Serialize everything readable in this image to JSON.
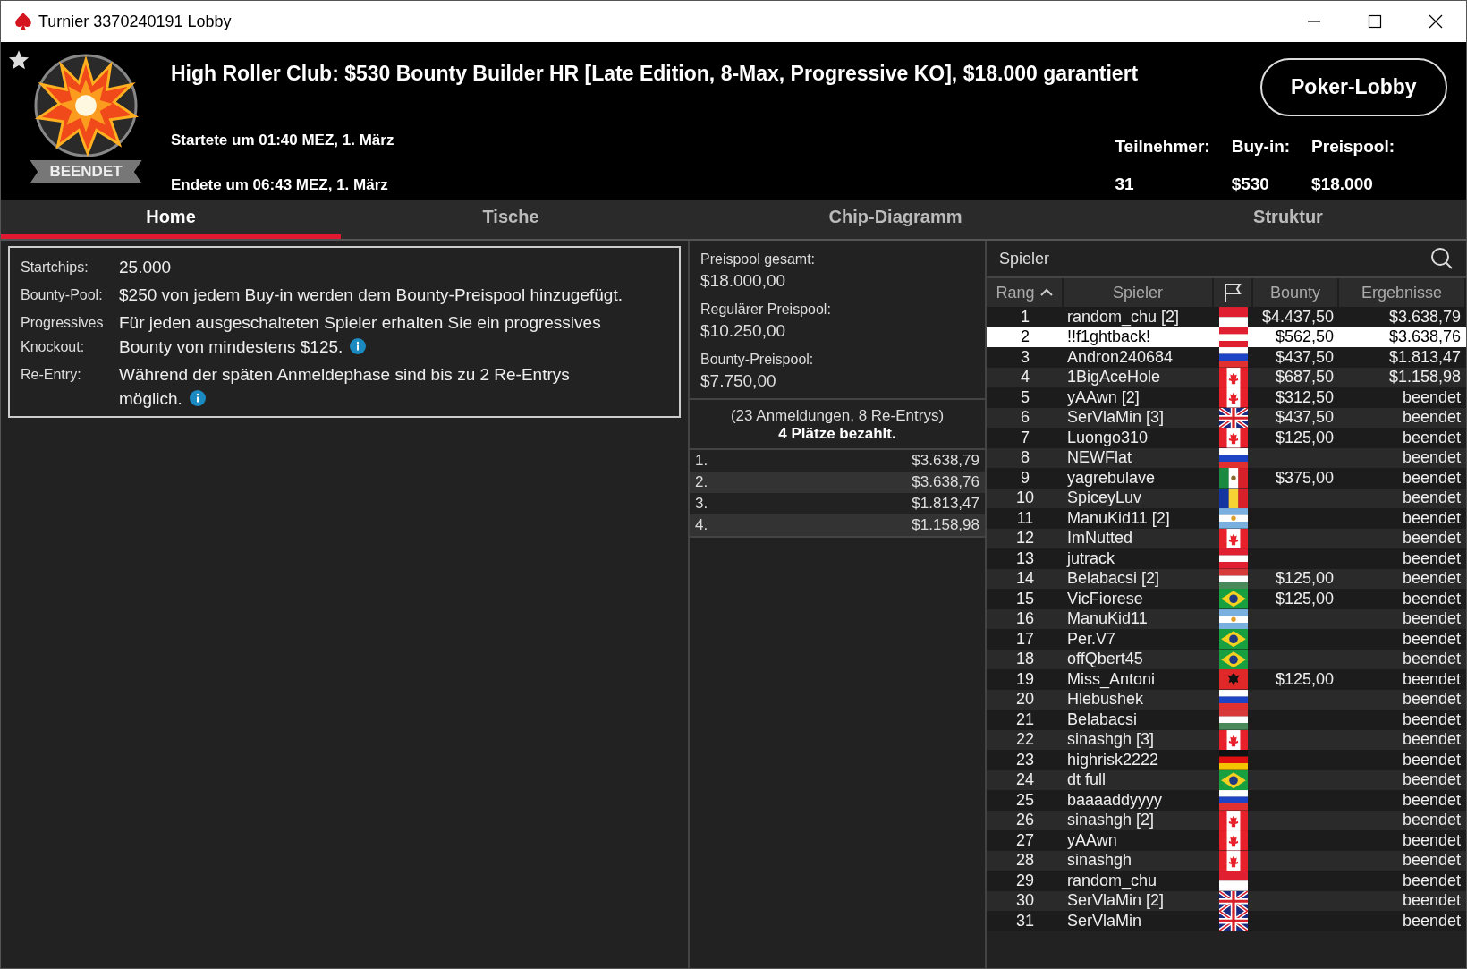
{
  "window": {
    "title": "Turnier 3370240191 Lobby"
  },
  "header": {
    "status": "BEENDET",
    "title": "High Roller Club: $530 Bounty Builder HR [Late Edition, 8-Max, Progressive KO], $18.000 garantiert",
    "started": "Startete um 01:40 MEZ, 1. März",
    "ended": "Endete um 06:43 MEZ, 1. März",
    "lobby_button": "Poker-Lobby",
    "stats": [
      {
        "label": "Teilnehmer:",
        "value": "31"
      },
      {
        "label": "Buy-in:",
        "value": "$530"
      },
      {
        "label": "Preispool:",
        "value": "$18.000"
      }
    ]
  },
  "tabs": [
    {
      "label": "Home",
      "selected": true
    },
    {
      "label": "Tische",
      "selected": false
    },
    {
      "label": "Chip-Diagramm",
      "selected": false
    },
    {
      "label": "Struktur",
      "selected": false
    }
  ],
  "info": [
    {
      "label": "Startchips:",
      "text": "25.000",
      "info_icon": false
    },
    {
      "label": "Bounty-Pool:",
      "text": "$250 von jedem Buy-in werden dem Bounty-Preispool hinzugefügt.",
      "info_icon": false
    },
    {
      "label": "Progressives Knockout:",
      "text": "Für jeden ausgeschalteten Spieler erhalten Sie ein progressives Bounty von mindestens $125.",
      "info_icon": true
    },
    {
      "label": "Re-Entry:",
      "text": "Während der späten Anmeldephase sind bis zu 2 Re-Entrys möglich.",
      "info_icon": true
    }
  ],
  "prizepool": [
    {
      "label": "Preispool gesamt:",
      "value": "$18.000,00"
    },
    {
      "label": "Regulärer Preispool:",
      "value": "$10.250,00"
    },
    {
      "label": "Bounty-Preispool:",
      "value": "$7.750,00"
    }
  ],
  "entries": "(23 Anmeldungen, 8 Re-Entrys)",
  "paid": "4 Plätze bezahlt.",
  "payouts": [
    {
      "place": "1.",
      "amount": "$3.638,79"
    },
    {
      "place": "2.",
      "amount": "$3.638,76"
    },
    {
      "place": "3.",
      "amount": "$1.813,47"
    },
    {
      "place": "4.",
      "amount": "$1.158,98"
    }
  ],
  "players": {
    "search_label": "Spieler",
    "columns": [
      "Rang",
      "Spieler",
      "Bounty",
      "Ergebnisse"
    ],
    "rows": [
      {
        "rank": "1",
        "name": "random_chu [2]",
        "kind": "id",
        "bounty": "$4.437,50",
        "result": "$3.638,79",
        "selected": false
      },
      {
        "rank": "2",
        "name": "!!f1ghtback!",
        "kind": "at",
        "bounty": "$562,50",
        "result": "$3.638,76",
        "selected": true
      },
      {
        "rank": "3",
        "name": "Andron240684",
        "kind": "ru",
        "bounty": "$437,50",
        "result": "$1.813,47",
        "selected": false
      },
      {
        "rank": "4",
        "name": "1BigAceHole",
        "kind": "ca",
        "bounty": "$687,50",
        "result": "$1.158,98",
        "selected": false
      },
      {
        "rank": "5",
        "name": "yAAwn [2]",
        "kind": "ca",
        "bounty": "$312,50",
        "result": "beendet",
        "selected": false
      },
      {
        "rank": "6",
        "name": "SerVlaMin [3]",
        "kind": "gb",
        "bounty": "$437,50",
        "result": "beendet",
        "selected": false
      },
      {
        "rank": "7",
        "name": "Luongo310",
        "kind": "ca",
        "bounty": "$125,00",
        "result": "beendet",
        "selected": false
      },
      {
        "rank": "8",
        "name": "NEWFlat",
        "kind": "ru",
        "result": "beendet",
        "selected": false
      },
      {
        "rank": "9",
        "name": "yagrebulave",
        "kind": "mx",
        "bounty": "$375,00",
        "result": "beendet",
        "selected": false
      },
      {
        "rank": "10",
        "name": "SpiceyLuv",
        "kind": "ro",
        "result": "beendet",
        "selected": false
      },
      {
        "rank": "11",
        "name": "ManuKid11 [2]",
        "kind": "ar",
        "result": "beendet",
        "selected": false
      },
      {
        "rank": "12",
        "name": "ImNutted",
        "kind": "ca",
        "result": "beendet",
        "selected": false
      },
      {
        "rank": "13",
        "name": "jutrack",
        "kind": "at",
        "result": "beendet",
        "selected": false
      },
      {
        "rank": "14",
        "name": "Belabacsi [2]",
        "kind": "hu",
        "bounty": "$125,00",
        "result": "beendet",
        "selected": false
      },
      {
        "rank": "15",
        "name": "VicFiorese",
        "kind": "br",
        "bounty": "$125,00",
        "result": "beendet",
        "selected": false
      },
      {
        "rank": "16",
        "name": "ManuKid11",
        "kind": "ar",
        "result": "beendet",
        "selected": false
      },
      {
        "rank": "17",
        "name": "Per.V7",
        "kind": "br",
        "result": "beendet",
        "selected": false
      },
      {
        "rank": "18",
        "name": "offQbert45",
        "kind": "br",
        "result": "beendet",
        "selected": false
      },
      {
        "rank": "19",
        "name": "Miss_Antoni",
        "kind": "al",
        "bounty": "$125,00",
        "result": "beendet",
        "selected": false
      },
      {
        "rank": "20",
        "name": "Hlebushek",
        "kind": "ru",
        "result": "beendet",
        "selected": false
      },
      {
        "rank": "21",
        "name": "Belabacsi",
        "kind": "hu",
        "result": "beendet",
        "selected": false
      },
      {
        "rank": "22",
        "name": "sinashgh [3]",
        "kind": "ca",
        "result": "beendet",
        "selected": false
      },
      {
        "rank": "23",
        "name": "highrisk2222",
        "kind": "de",
        "result": "beendet",
        "selected": false
      },
      {
        "rank": "24",
        "name": "dt full",
        "kind": "br",
        "result": "beendet",
        "selected": false
      },
      {
        "rank": "25",
        "name": "baaaaddyyyy",
        "kind": "ru",
        "result": "beendet",
        "selected": false
      },
      {
        "rank": "26",
        "name": "sinashgh [2]",
        "kind": "ca",
        "result": "beendet",
        "selected": false
      },
      {
        "rank": "27",
        "name": "yAAwn",
        "kind": "ca",
        "result": "beendet",
        "selected": false
      },
      {
        "rank": "28",
        "name": "sinashgh",
        "kind": "ca",
        "result": "beendet",
        "selected": false
      },
      {
        "rank": "29",
        "name": "random_chu",
        "kind": "id",
        "result": "beendet",
        "selected": false
      },
      {
        "rank": "30",
        "name": "SerVlaMin [2]",
        "kind": "gb",
        "result": "beendet",
        "selected": false
      },
      {
        "rank": "31",
        "name": "SerVlaMin",
        "kind": "gb",
        "result": "beendet",
        "selected": false
      }
    ]
  }
}
